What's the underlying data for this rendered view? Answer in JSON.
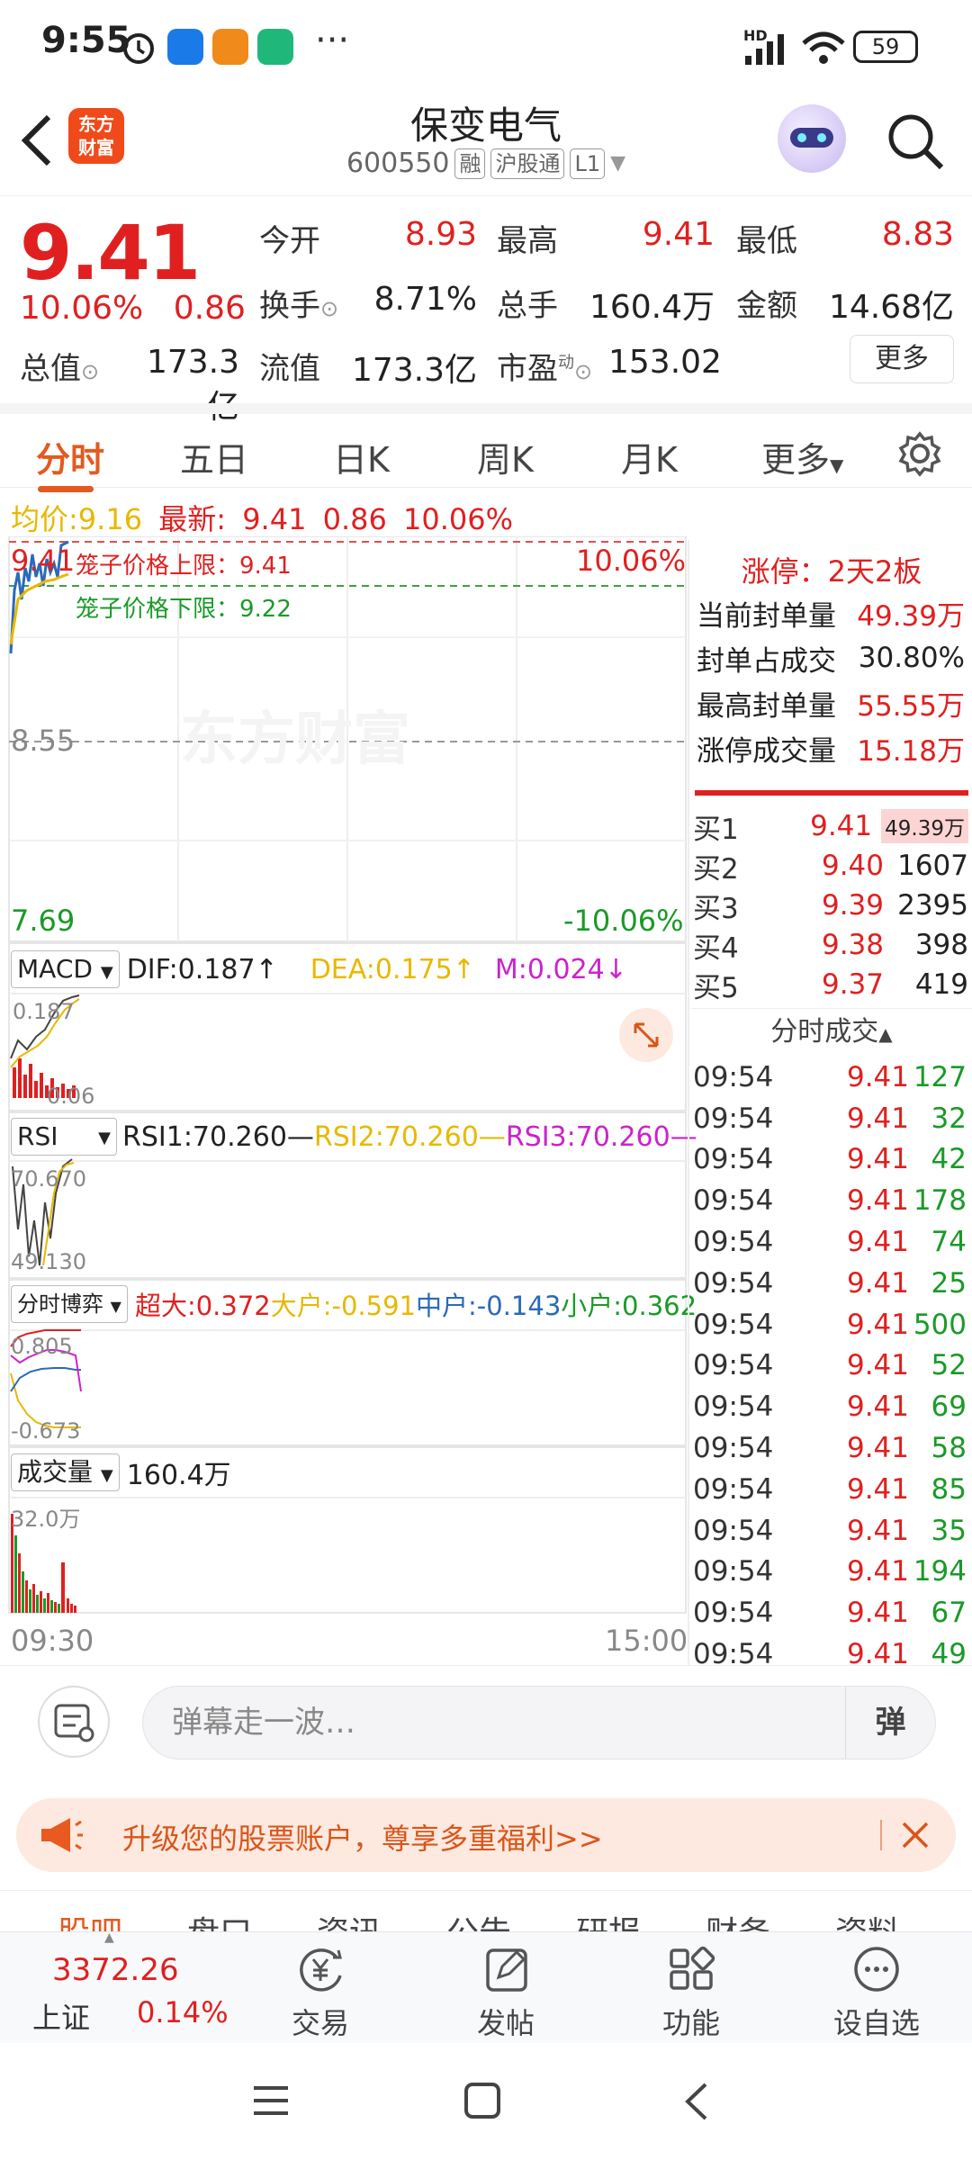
{
  "status_bar": {
    "time": "9:55",
    "battery": "59",
    "dots": "···",
    "hd": "HD"
  },
  "header": {
    "back_icon": "chevron-left-icon",
    "logo_text_1": "东方",
    "logo_text_2": "财富",
    "title": "保变电气",
    "code": "600550",
    "tags": [
      "融",
      "沪股通",
      "L1"
    ],
    "search_icon": "search-icon"
  },
  "quote": {
    "price": "9.41",
    "change_pct": "10.06%",
    "change_amt": "0.86",
    "fields": [
      {
        "label": "今开",
        "value": "8.93",
        "color": "red"
      },
      {
        "label": "最高",
        "value": "9.41",
        "color": "red"
      },
      {
        "label": "最低",
        "value": "8.83",
        "color": "red"
      },
      {
        "label": "换手",
        "value": "8.71%",
        "color": "black"
      },
      {
        "label": "总手",
        "value": "160.4万",
        "color": "black"
      },
      {
        "label": "金额",
        "value": "14.68亿",
        "color": "black"
      },
      {
        "label": "总值",
        "value": "173.3亿",
        "color": "black"
      },
      {
        "label": "流值",
        "value": "173.3亿",
        "color": "black"
      },
      {
        "label": "市盈",
        "value": "153.02",
        "color": "black"
      }
    ],
    "pe_superscript": "动",
    "more_label": "更多"
  },
  "tabs": [
    "分时",
    "五日",
    "日K",
    "周K",
    "月K",
    "更多"
  ],
  "summary": {
    "avg_label": "均价:",
    "avg_value": "9.16",
    "latest_label": "最新:",
    "latest_value": "9.41",
    "latest_change": "0.86",
    "latest_pct": "10.06%"
  },
  "intraday": {
    "price_top": "9.41",
    "price_mid": "8.55",
    "price_bottom": "7.69",
    "pct_top": "10.06%",
    "pct_bottom": "-10.06%",
    "cage_upper": "笼子价格上限：9.41",
    "cage_lower": "笼子价格下限：9.22",
    "watermark": "东方财富",
    "time_start": "09:30",
    "time_end": "15:00"
  },
  "macd": {
    "label": "MACD",
    "dif": "DIF:0.187↑",
    "dea": "DEA:0.175↑",
    "m": "M:0.024↓",
    "top": "0.187",
    "bottom": "0.06"
  },
  "rsi": {
    "label": "RSI",
    "rsi1": "RSI1:70.260—",
    "rsi2": "RSI2:70.260—",
    "rsi3": "RSI3:70.260—",
    "top": "70.670",
    "bottom": "49.130"
  },
  "flow": {
    "label": "分时博弈",
    "super": "超大:0.372",
    "big": "大户:-0.591",
    "mid": "中户:-0.143",
    "small": "小户:0.362",
    "top": "0.805",
    "bottom": "-0.673"
  },
  "volume": {
    "label": "成交量",
    "value": "160.4万",
    "top": "32.0万"
  },
  "limit_up": {
    "title": "涨停：2天2板",
    "rows": [
      {
        "label": "当前封单量",
        "value": "49.39万",
        "color": "red"
      },
      {
        "label": "封单占成交",
        "value": "30.80%",
        "color": "black"
      },
      {
        "label": "最高封单量",
        "value": "55.55万",
        "color": "red"
      },
      {
        "label": "涨停成交量",
        "value": "15.18万",
        "color": "red"
      }
    ]
  },
  "bids": [
    {
      "label": "买1",
      "price": "9.41",
      "vol": "49.39万"
    },
    {
      "label": "买2",
      "price": "9.40",
      "vol": "1607"
    },
    {
      "label": "买3",
      "price": "9.39",
      "vol": "2395"
    },
    {
      "label": "买4",
      "price": "9.38",
      "vol": "398"
    },
    {
      "label": "买5",
      "price": "9.37",
      "vol": "419"
    }
  ],
  "trades_title": "分时成交",
  "trades": [
    {
      "time": "09:54",
      "price": "9.41",
      "vol": "127"
    },
    {
      "time": "09:54",
      "price": "9.41",
      "vol": "32"
    },
    {
      "time": "09:54",
      "price": "9.41",
      "vol": "42"
    },
    {
      "time": "09:54",
      "price": "9.41",
      "vol": "178"
    },
    {
      "time": "09:54",
      "price": "9.41",
      "vol": "74"
    },
    {
      "time": "09:54",
      "price": "9.41",
      "vol": "25"
    },
    {
      "time": "09:54",
      "price": "9.41",
      "vol": "500"
    },
    {
      "time": "09:54",
      "price": "9.41",
      "vol": "52"
    },
    {
      "time": "09:54",
      "price": "9.41",
      "vol": "69"
    },
    {
      "time": "09:54",
      "price": "9.41",
      "vol": "58"
    },
    {
      "time": "09:54",
      "price": "9.41",
      "vol": "85"
    },
    {
      "time": "09:54",
      "price": "9.41",
      "vol": "35"
    },
    {
      "time": "09:54",
      "price": "9.41",
      "vol": "194"
    },
    {
      "time": "09:54",
      "price": "9.41",
      "vol": "67"
    },
    {
      "time": "09:54",
      "price": "9.41",
      "vol": "49"
    }
  ],
  "danmaku": {
    "placeholder": "弹幕走一波…",
    "send": "弹"
  },
  "promo": {
    "text": "升级您的股票账户，尊享多重福利>>"
  },
  "cut_tabs": [
    "股吧",
    "盘口",
    "资讯",
    "公告",
    "研报",
    "财务",
    "资料"
  ],
  "bottom_nav": {
    "index_value": "3372.26",
    "index_name": "上证",
    "index_pct": "0.14%",
    "items": [
      "交易",
      "发帖",
      "功能",
      "设自选"
    ]
  },
  "colors": {
    "up": "#e02020",
    "down": "#1a9a28",
    "accent": "#e25a20",
    "yellow": "#e8b800",
    "purple": "#cc22cc",
    "blue": "#2a6ab8"
  }
}
